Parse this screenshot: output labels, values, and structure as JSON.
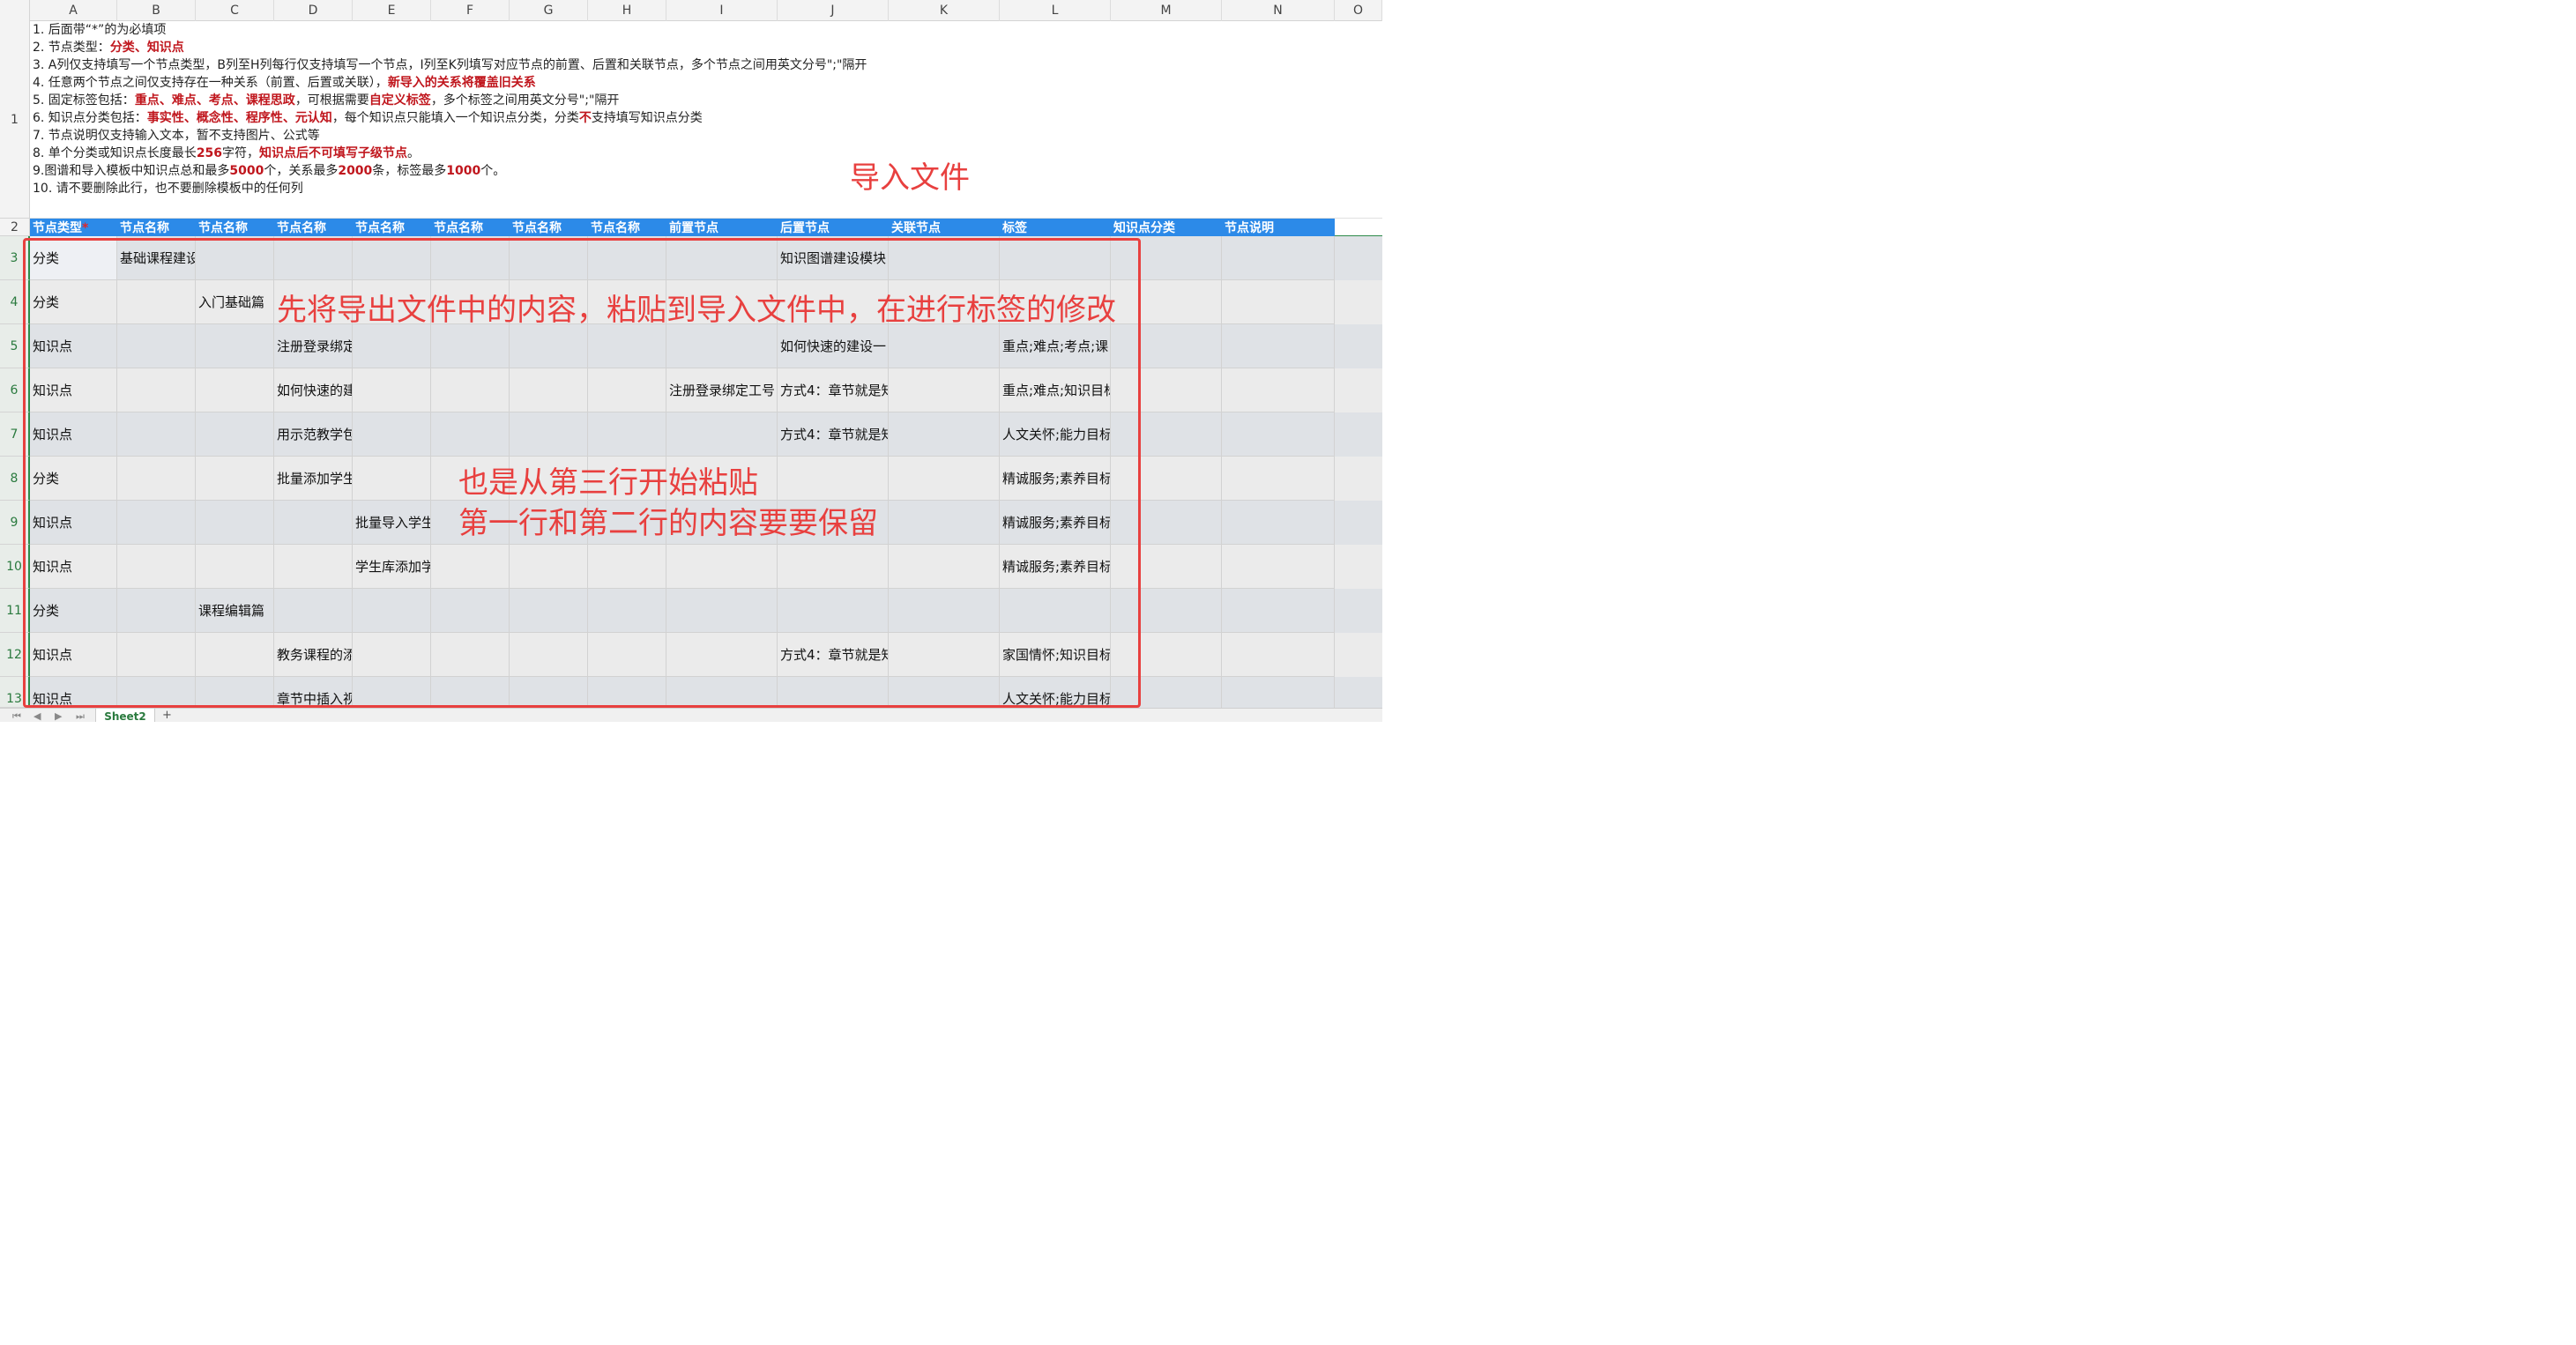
{
  "columns": [
    "A",
    "B",
    "C",
    "D",
    "E",
    "F",
    "G",
    "H",
    "I",
    "J",
    "K",
    "L",
    "M",
    "N",
    "O"
  ],
  "row_numbers": [
    "1",
    "2",
    "3",
    "4",
    "5",
    "6",
    "7",
    "8",
    "9",
    "10",
    "11",
    "12",
    "13"
  ],
  "instructions": {
    "l1": "1. 后面带“*”的为必填项",
    "l2a": "2. 节点类型：",
    "l2b": "分类",
    "l2c": "、",
    "l2d": "知识点",
    "l3": "3. A列仅支持填写一个节点类型，B列至H列每行仅支持填写一个节点，I列至K列填写对应节点的前置、后置和关联节点，多个节点之间用英文分号\";\"隔开",
    "l4a": "4. 任意两个节点之间仅支持存在一种关系（前置、后置或关联），",
    "l4b": "新导入的关系将覆盖旧关系",
    "l5a": "5. 固定标签包括：",
    "l5b": "重点",
    "l5c": "、",
    "l5d": "难点",
    "l5e": "、",
    "l5f": "考点",
    "l5g": "、",
    "l5h": "课程思政",
    "l5i": "，可根据需要",
    "l5j": "自定义标签",
    "l5k": "，多个标签之间用英文分号\";\"隔开",
    "l6a": "6. 知识点分类包括：",
    "l6b": "事实性",
    "l6c": "、",
    "l6d": "概念性",
    "l6e": "、",
    "l6f": "程序性",
    "l6g": "、",
    "l6h": "元认知",
    "l6i": "，每个知识点只能填入一个知识点分类，分类",
    "l6j": "不",
    "l6k": "支持填写知识点分类",
    "l7": "7. 节点说明仅支持输入文本，暂不支持图片、公式等",
    "l8a": "8. 单个分类或知识点长度最长",
    "l8b": "256",
    "l8c": "字符，",
    "l8d": "知识点后不可填写子级节点",
    "l8e": "。",
    "l9a": "9.图谱和导入模板中知识点总和最多",
    "l9b": "5000",
    "l9c": "个，关系最多",
    "l9d": "2000",
    "l9e": "条，标签最多",
    "l9f": "1000",
    "l9g": "个。",
    "l10": "10. 请不要删除此行，也不要删除模板中的任何列"
  },
  "import_title": "导入文件",
  "headers": {
    "a": "节点类型",
    "a_star": "*",
    "b": "节点名称",
    "c": "节点名称",
    "d": "节点名称",
    "e": "节点名称",
    "f": "节点名称",
    "g": "节点名称",
    "h": "节点名称",
    "i": "前置节点",
    "j": "后置节点",
    "k": "关联节点",
    "l": "标签",
    "m": "知识点分类",
    "n": "节点说明"
  },
  "rows": [
    {
      "a": "分类",
      "b": "基础课程建设",
      "c": "",
      "d": "",
      "e": "",
      "i": "",
      "j": "知识图谱建设模块",
      "l": ""
    },
    {
      "a": "分类",
      "b": "",
      "c": "入门基础篇",
      "d": "",
      "e": "",
      "i": "",
      "j": "",
      "l": ""
    },
    {
      "a": "知识点",
      "b": "",
      "c": "",
      "d": "注册登录绑定",
      "e": "",
      "i": "",
      "j": "如何快速的建设一",
      "l": "重点;难点;考点;课"
    },
    {
      "a": "知识点",
      "b": "",
      "c": "",
      "d": "如何快速的建",
      "e": "",
      "i": "注册登录绑定工号",
      "j": "方式4：章节就是知",
      "l": "重点;难点;知识目标"
    },
    {
      "a": "知识点",
      "b": "",
      "c": "",
      "d": "用示范教学包",
      "e": "",
      "i": "",
      "j": "方式4：章节就是知",
      "l": "人文关怀;能力目标"
    },
    {
      "a": "分类",
      "b": "",
      "c": "",
      "d": "批量添加学生",
      "e": "",
      "i": "",
      "j": "",
      "l": "精诚服务;素养目标"
    },
    {
      "a": "知识点",
      "b": "",
      "c": "",
      "d": "",
      "e": "批量导入学生",
      "i": "",
      "j": "",
      "l": "精诚服务;素养目标"
    },
    {
      "a": "知识点",
      "b": "",
      "c": "",
      "d": "",
      "e": "学生库添加学",
      "i": "",
      "j": "",
      "l": "精诚服务;素养目标"
    },
    {
      "a": "分类",
      "b": "",
      "c": "课程编辑篇",
      "d": "",
      "e": "",
      "i": "",
      "j": "",
      "l": ""
    },
    {
      "a": "知识点",
      "b": "",
      "c": "",
      "d": "教务课程的添",
      "e": "",
      "i": "",
      "j": "方式4：章节就是知",
      "l": "家国情怀;知识目标"
    },
    {
      "a": "知识点",
      "b": "",
      "c": "",
      "d": "章节中插入视",
      "e": "",
      "i": "",
      "j": "",
      "l": "人文关怀;能力目标"
    }
  ],
  "annotations": {
    "main": "先将导出文件中的内容，粘贴到导入文件中，在进行标签的修改",
    "line1": "也是从第三行开始粘贴",
    "line2": "第一行和第二行的内容要要保留"
  },
  "sheet_tab": "Sheet2",
  "add_tab": "+",
  "colors": {
    "header_blue": "#2c8ae8",
    "annotation_red": "#e8403f",
    "instruction_red": "#c0161d",
    "row_number_green": "#2a7a3e"
  }
}
